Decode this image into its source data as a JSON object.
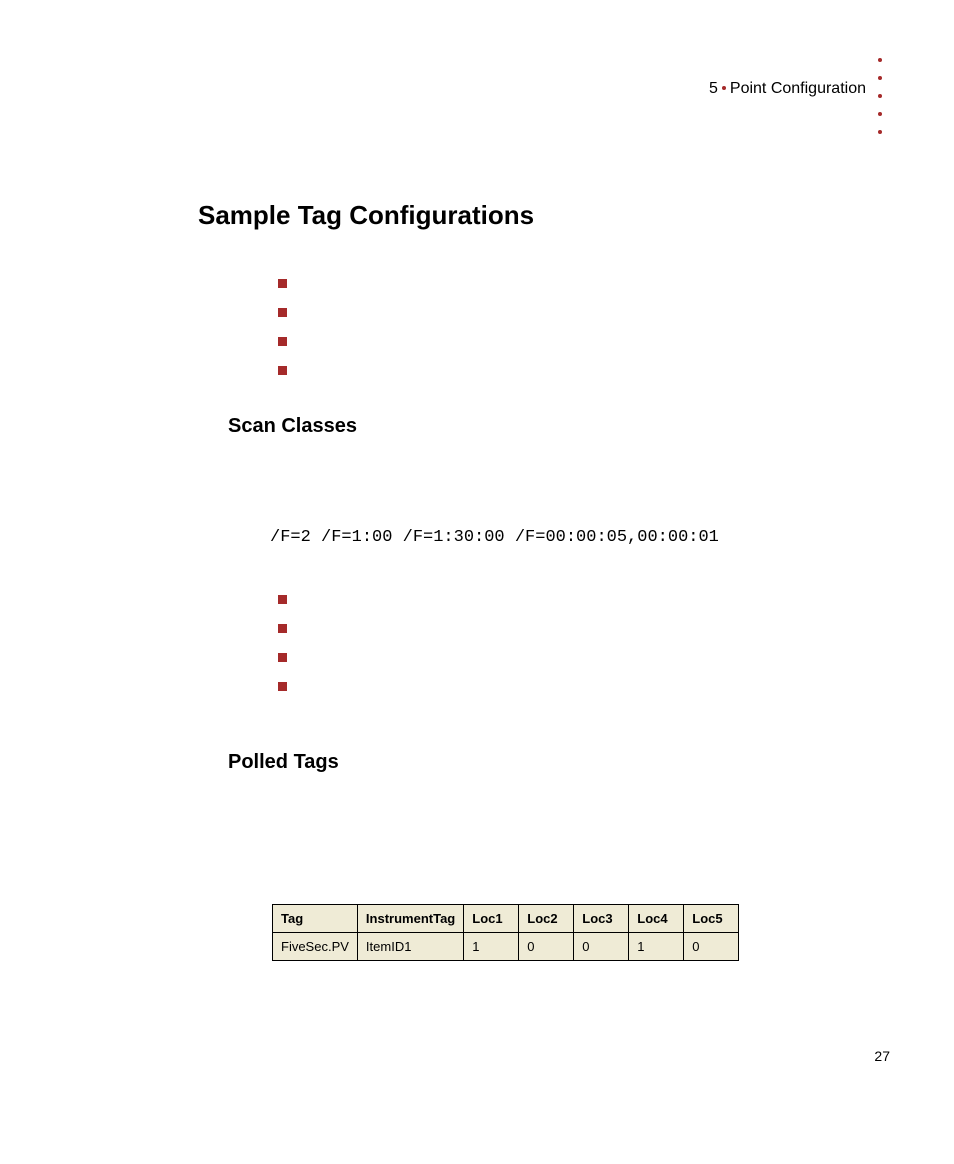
{
  "header": {
    "chapter_num": "5",
    "chapter_title": "Point Configuration"
  },
  "title": "Sample Tag Configurations",
  "section_scan": "Scan Classes",
  "code_line": "/F=2 /F=1:00 /F=1:30:00 /F=00:00:05,00:00:01",
  "section_polled": "Polled Tags",
  "table": {
    "headers": [
      "Tag",
      "InstrumentTag",
      "Loc1",
      "Loc2",
      "Loc3",
      "Loc4",
      "Loc5"
    ],
    "row": [
      "FiveSec.PV",
      "ItemID1",
      "1",
      "0",
      "0",
      "1",
      "0"
    ]
  },
  "page_number": "27"
}
